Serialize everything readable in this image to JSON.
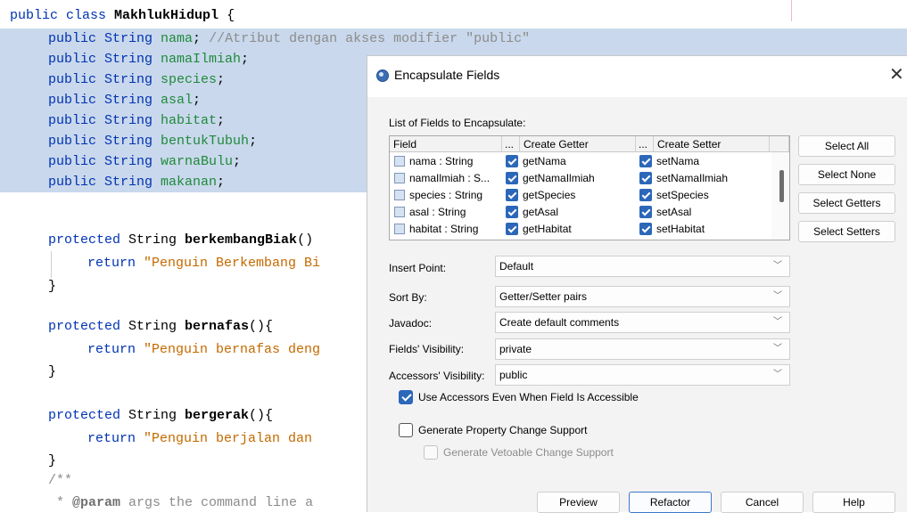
{
  "editor": {
    "class_decl": {
      "kw": "public class ",
      "name": "MakhlukHidupl",
      "brace": " {"
    },
    "fields": [
      {
        "mods": "public String ",
        "name": "nama",
        "tail": ";",
        "comment": " //Atribut dengan akses modifier \"public\""
      },
      {
        "mods": "public String ",
        "name": "namaIlmiah",
        "tail": ";",
        "comment": ""
      },
      {
        "mods": "public String ",
        "name": "species",
        "tail": ";",
        "comment": ""
      },
      {
        "mods": "public String ",
        "name": "asal",
        "tail": ";",
        "comment": ""
      },
      {
        "mods": "public String ",
        "name": "habitat",
        "tail": ";",
        "comment": ""
      },
      {
        "mods": "public String ",
        "name": "bentukTubuh",
        "tail": ";",
        "comment": ""
      },
      {
        "mods": "public String ",
        "name": "warnaBulu",
        "tail": ";",
        "comment": ""
      },
      {
        "mods": "public String ",
        "name": "makanan",
        "tail": ";",
        "comment": ""
      }
    ],
    "methods": [
      {
        "kw": "protected",
        "type": " String ",
        "name": "berkembangBiak",
        "sig": "()",
        "ret_kw": "return ",
        "ret_str": "\"Penguin Berkembang Bi"
      },
      {
        "kw": "protected",
        "type": " String ",
        "name": "bernafas",
        "sig": "(){",
        "ret_kw": "return ",
        "ret_str": "\"Penguin bernafas deng"
      },
      {
        "kw": "protected",
        "type": " String ",
        "name": "bergerak",
        "sig": "(){",
        "ret_kw": "return ",
        "ret_str": "\"Penguin berjalan dan "
      }
    ],
    "closing_brace": "}",
    "doc_open": "/**",
    "doc_param": {
      "star": " * ",
      "tag": "@param",
      "text": " args the command line a"
    }
  },
  "dialog": {
    "title": "Encapsulate Fields",
    "close_glyph": "✕",
    "list_label": "List of Fields to Encapsulate:",
    "columns": {
      "field": "Field",
      "dots1": "...",
      "getter": "Create Getter",
      "dots2": "...",
      "setter": "Create Setter"
    },
    "rows": [
      {
        "field": "nama : String",
        "getter": "getNama",
        "setter": "setNama"
      },
      {
        "field": "namaIlmiah : S...",
        "getter": "getNamaIlmiah",
        "setter": "setNamaIlmiah"
      },
      {
        "field": "species : String",
        "getter": "getSpecies",
        "setter": "setSpecies"
      },
      {
        "field": "asal : String",
        "getter": "getAsal",
        "setter": "setAsal"
      },
      {
        "field": "habitat : String",
        "getter": "getHabitat",
        "setter": "setHabitat"
      }
    ],
    "side_buttons": {
      "select_all": "Select All",
      "select_none": "Select None",
      "select_getters": "Select Getters",
      "select_setters": "Select Setters"
    },
    "insert_point": {
      "label": "Insert Point:",
      "value": "Default"
    },
    "sort_by": {
      "label": "Sort By:",
      "value": "Getter/Setter pairs"
    },
    "javadoc": {
      "label": "Javadoc:",
      "value": "Create default comments"
    },
    "fields_visibility": {
      "label": "Fields' Visibility:",
      "value": "private"
    },
    "accessors_visibility": {
      "label": "Accessors' Visibility:",
      "value": "public"
    },
    "chevron": "﹀",
    "use_accessors": {
      "label": "Use Accessors Even When Field Is Accessible",
      "checked": true
    },
    "property_change": {
      "label": "Generate Property Change Support",
      "checked": false
    },
    "vetoable_change": {
      "label": "Generate Vetoable Change Support",
      "checked": false,
      "enabled": false
    },
    "footer": {
      "preview": "Preview",
      "refactor": "Refactor",
      "cancel": "Cancel",
      "help": "Help"
    }
  }
}
